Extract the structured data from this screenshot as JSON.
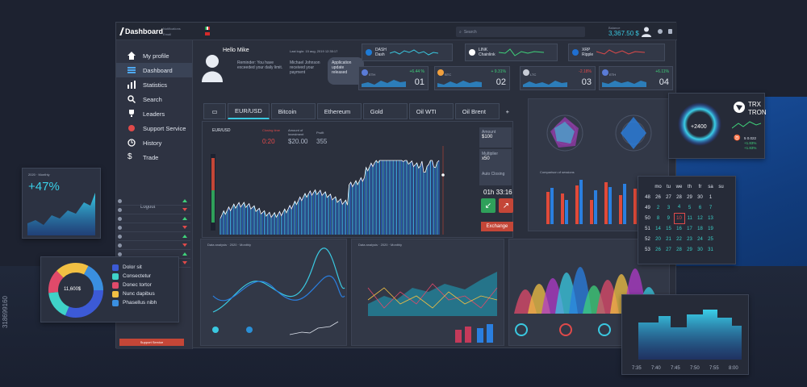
{
  "header": {
    "logo": "Dashboard",
    "lang1": "Notifications",
    "lang2": "Email",
    "search_placeholder": "Search",
    "balance_label": "Balance",
    "balance_value": "3,367.50 $"
  },
  "sidebar": {
    "items": [
      {
        "label": "My profile",
        "icon": "user-icon"
      },
      {
        "label": "Dashboard",
        "icon": "list-icon"
      },
      {
        "label": "Statistics",
        "icon": "bar-chart-icon"
      },
      {
        "label": "Search",
        "icon": "search-icon"
      },
      {
        "label": "Leaders",
        "icon": "trophy-icon"
      },
      {
        "label": "Support Service",
        "icon": "support-icon"
      },
      {
        "label": "History",
        "icon": "clock-icon"
      },
      {
        "label": "Trade",
        "icon": "dollar-icon"
      }
    ],
    "logout": "Logout",
    "support_button": "Support Service"
  },
  "hello": {
    "name": "Hello Mike",
    "last_login": "Last login: 15 aug, 2019 12:35:17",
    "reminder": "Reminder: You have exceeded your daily limit.",
    "message": "Michael Johnson received your payment",
    "update": "Application update released"
  },
  "tickers": [
    {
      "symbol": "DASH",
      "name": "Dash",
      "color": "#1e7bd6"
    },
    {
      "symbol": "LINK",
      "name": "Chainlink",
      "color": "#ffffff"
    },
    {
      "symbol": "XRP",
      "name": "Ripple",
      "color": "#1f6fd1"
    }
  ],
  "stats": [
    {
      "coin": "ETH",
      "num": "01",
      "pct": "+6.44 %",
      "color": "#5a7bd6"
    },
    {
      "coin": "BTC",
      "num": "02",
      "pct": "+ 9.31%",
      "color": "#f2a03d"
    },
    {
      "coin": "LTC",
      "num": "03",
      "pct": "-2.18%",
      "color": "#c7ccd6"
    },
    {
      "coin": "ETH",
      "num": "04",
      "pct": "+6.11%",
      "color": "#5a7bd6"
    }
  ],
  "tabs": [
    "EUR/USD",
    "Bitcoin",
    "Ethereum",
    "Gold",
    "Oil WTI",
    "Oil Brent"
  ],
  "trade": {
    "pair": "EUR/USD",
    "closing_label": "Closing time",
    "closing_value": "0:20",
    "amount_label": "Amount of investment",
    "amount_value": "$20.00",
    "profit_label": "Profit",
    "profit_value": "355",
    "amount_box_label": "Amount",
    "amount_box_value": "$100",
    "multiplier_label": "Multiplier",
    "multiplier_value": "x50",
    "auto_label": "Auto Closing",
    "timer": "01h 33:16",
    "exchange": "Exchange"
  },
  "comparison": {
    "title": "Comparison of sessions"
  },
  "analysis": {
    "title": "Data analysis",
    "year": "2020",
    "period": "Monthly"
  },
  "trx": {
    "name": "TRX TRON",
    "ring_value": "+2400",
    "v1": "5 0.022",
    "v2": "+1.83%",
    "v3": "+1.83%"
  },
  "big_stat": {
    "value": "+47%",
    "year": "2020",
    "period": "Monthly"
  },
  "donut": {
    "center": "11,600$",
    "legend": [
      {
        "label": "Dolor sit",
        "color": "#3c5ad6"
      },
      {
        "label": "Consectetur",
        "color": "#3fd2c8"
      },
      {
        "label": "Donec tortor",
        "color": "#e04a6a"
      },
      {
        "label": "Nunc dapibus",
        "color": "#f2c043"
      },
      {
        "label": "Phasellus nibh",
        "color": "#3a8fe0"
      }
    ]
  },
  "calendar": {
    "weekdays": [
      "mo",
      "tu",
      "we",
      "th",
      "fr",
      "sa",
      "su"
    ],
    "rows": [
      [
        "48",
        "26",
        "27",
        "28",
        "29",
        "30",
        "1"
      ],
      [
        "49",
        "2",
        "3",
        "4",
        "5",
        "6",
        "7"
      ],
      [
        "50",
        "8",
        "9",
        "10",
        "11",
        "12",
        "13"
      ],
      [
        "51",
        "14",
        "15",
        "16",
        "17",
        "18",
        "19"
      ],
      [
        "52",
        "20",
        "21",
        "22",
        "23",
        "24",
        "25"
      ],
      [
        "53",
        "26",
        "27",
        "28",
        "29",
        "30",
        "31"
      ]
    ]
  },
  "times": [
    "7:35",
    "7:40",
    "7:45",
    "7:50",
    "7:55",
    "8:00"
  ],
  "watermark": "318699160"
}
